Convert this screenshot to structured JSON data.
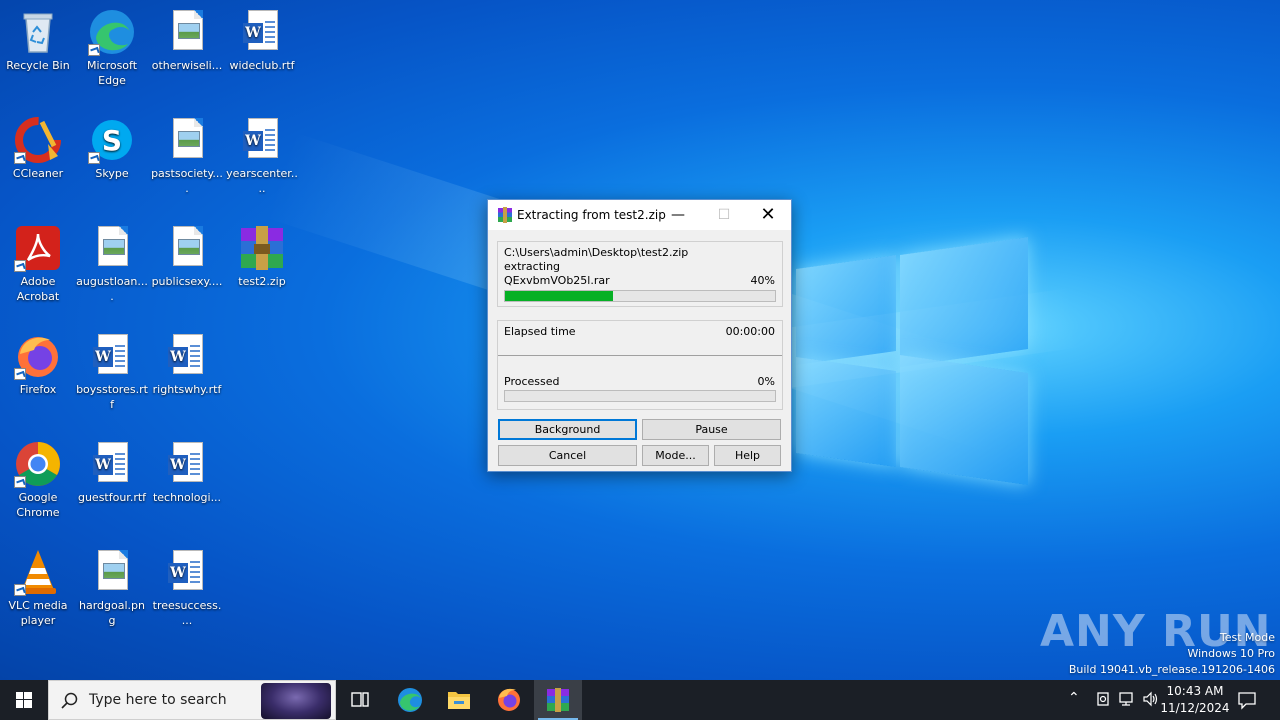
{
  "desktop": {
    "icons": [
      {
        "label": "Recycle Bin",
        "icon": "recycle-bin-icon"
      },
      {
        "label": "Microsoft Edge",
        "icon": "edge-icon"
      },
      {
        "label": "otherwiseli...",
        "icon": "image-file-icon"
      },
      {
        "label": "wideclub.rtf",
        "icon": "word-document-icon"
      },
      {
        "label": "CCleaner",
        "icon": "ccleaner-icon"
      },
      {
        "label": "Skype",
        "icon": "skype-icon"
      },
      {
        "label": "pastsociety....",
        "icon": "image-file-icon"
      },
      {
        "label": "yearscenter....",
        "icon": "word-document-icon"
      },
      {
        "label": "Adobe Acrobat",
        "icon": "acrobat-icon"
      },
      {
        "label": "augustloan....",
        "icon": "image-file-icon"
      },
      {
        "label": "publicsexy....",
        "icon": "image-file-icon"
      },
      {
        "label": "test2.zip",
        "icon": "winrar-archive-icon"
      },
      {
        "label": "Firefox",
        "icon": "firefox-icon"
      },
      {
        "label": "boysstores.rtf",
        "icon": "word-document-icon"
      },
      {
        "label": "rightswhy.rtf",
        "icon": "word-document-icon"
      },
      {
        "label": "Google Chrome",
        "icon": "chrome-icon"
      },
      {
        "label": "guestfour.rtf",
        "icon": "word-document-icon"
      },
      {
        "label": "technologi...",
        "icon": "word-document-icon"
      },
      {
        "label": "VLC media player",
        "icon": "vlc-icon"
      },
      {
        "label": "hardgoal.png",
        "icon": "image-file-icon"
      },
      {
        "label": "treesuccess....",
        "icon": "word-document-icon"
      }
    ]
  },
  "dialog": {
    "title": "Extracting from test2.zip",
    "archive_path": "C:\\Users\\admin\\Desktop\\test2.zip",
    "action": "extracting",
    "current_file": "QExvbmVOb25l.rar",
    "file_percent_label": "40%",
    "file_progress": 0.4,
    "elapsed_label": "Elapsed time",
    "elapsed_value": "00:00:00",
    "processed_label": "Processed",
    "processed_percent_label": "0%",
    "processed_progress": 0.0,
    "buttons": {
      "background": "Background",
      "pause": "Pause",
      "cancel": "Cancel",
      "mode": "Mode...",
      "help": "Help"
    }
  },
  "watermark": {
    "brand": "ANY RUN",
    "line1": "Test Mode",
    "line2": "Windows 10 Pro",
    "line3": "Build 19041.vb_release.191206-1406"
  },
  "taskbar": {
    "search_placeholder": "Type here to search",
    "time": "10:43 AM",
    "date": "11/12/2024"
  },
  "colors": {
    "accent": "#0078d7",
    "progress": "#06b025",
    "taskbar": "#1b1f26"
  }
}
